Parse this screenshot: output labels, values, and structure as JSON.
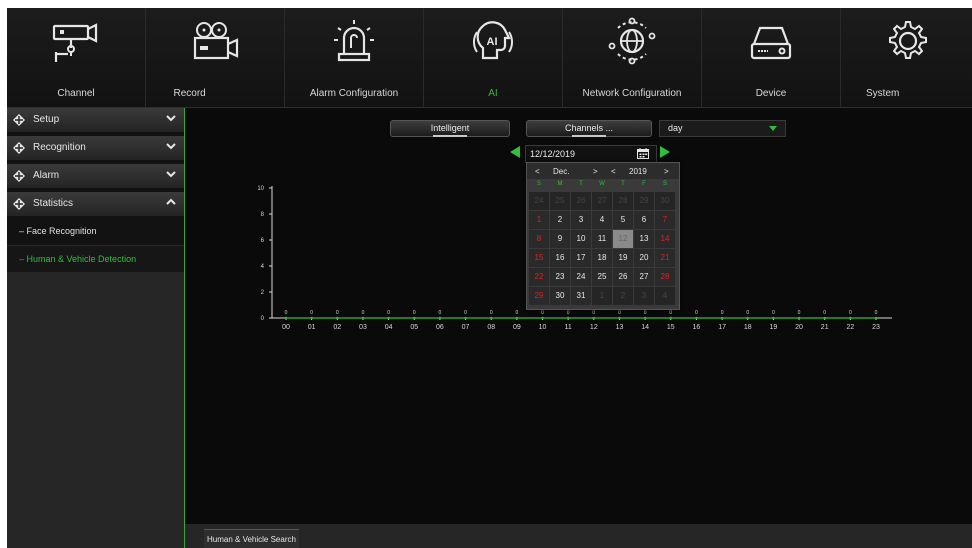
{
  "topmenu": [
    {
      "label": "Channel",
      "icon": "camera-icon",
      "active": false
    },
    {
      "label": "Record",
      "icon": "video-camera-icon",
      "active": false
    },
    {
      "label": "Alarm Configuration",
      "icon": "alarm-siren-icon",
      "active": false
    },
    {
      "label": "AI",
      "icon": "ai-head-icon",
      "active": true
    },
    {
      "label": "Network Configuration",
      "icon": "network-globe-icon",
      "active": false
    },
    {
      "label": "Device",
      "icon": "hard-drive-icon",
      "active": false
    },
    {
      "label": "System",
      "icon": "gear-icon",
      "active": false
    }
  ],
  "sidebar": {
    "sections": [
      {
        "label": "Setup",
        "expanded": false
      },
      {
        "label": "Recognition",
        "expanded": false
      },
      {
        "label": "Alarm",
        "expanded": false
      },
      {
        "label": "Statistics",
        "expanded": true
      }
    ],
    "subitems": [
      {
        "label": "Face Recognition",
        "active": false
      },
      {
        "label": "Human & Vehicle Detection",
        "active": true
      }
    ]
  },
  "toolbar": {
    "intelligent_label": "Intelligent",
    "channels_label": "Channels ...",
    "period_value": "day"
  },
  "date_nav": {
    "date_value": "12/12/2019"
  },
  "calendar": {
    "month": "Dec.",
    "year": "2019",
    "prev_month": "<",
    "next_month": ">",
    "prev_year": "<",
    "next_year": ">",
    "weekdays": [
      "S",
      "M",
      "T",
      "W",
      "T",
      "F",
      "S"
    ],
    "weeks": [
      [
        "24",
        "25",
        "26",
        "27",
        "28",
        "29",
        "30"
      ],
      [
        "1",
        "2",
        "3",
        "4",
        "5",
        "6",
        "7"
      ],
      [
        "8",
        "9",
        "10",
        "11",
        "12",
        "13",
        "14"
      ],
      [
        "15",
        "16",
        "17",
        "18",
        "19",
        "20",
        "21"
      ],
      [
        "22",
        "23",
        "24",
        "25",
        "26",
        "27",
        "28"
      ],
      [
        "29",
        "30",
        "31",
        "1",
        "2",
        "3",
        "4"
      ]
    ],
    "selected_day": "12"
  },
  "chart_data": {
    "type": "line",
    "x": [
      "00",
      "01",
      "02",
      "03",
      "04",
      "05",
      "06",
      "07",
      "08",
      "09",
      "10",
      "11",
      "12",
      "13",
      "14",
      "15",
      "16",
      "17",
      "18",
      "19",
      "20",
      "21",
      "22",
      "23"
    ],
    "y_ticks": [
      "0",
      "2",
      "4",
      "6",
      "8",
      "10"
    ],
    "ylim": [
      0,
      10
    ],
    "series": [
      {
        "values": [
          0,
          0,
          0,
          0,
          0,
          0,
          0,
          0,
          0,
          0,
          0,
          0,
          0,
          0,
          0,
          0,
          0,
          0,
          0,
          0,
          0,
          0,
          0,
          0
        ],
        "color": "#2fbf3a"
      }
    ],
    "data_labels": [
      "0",
      "0",
      "0",
      "0",
      "0",
      "0",
      "0",
      "0",
      "0",
      "0",
      "0",
      "0",
      "0",
      "0",
      "0",
      "0",
      "0",
      "0",
      "0",
      "0",
      "0",
      "0",
      "0",
      "0"
    ]
  },
  "bottom_tabs": [
    {
      "label": "Human & Vehicle Search"
    }
  ],
  "colors": {
    "accent": "#2fbf3a",
    "weekend": "#d22222",
    "background": "#0a0a0a"
  }
}
